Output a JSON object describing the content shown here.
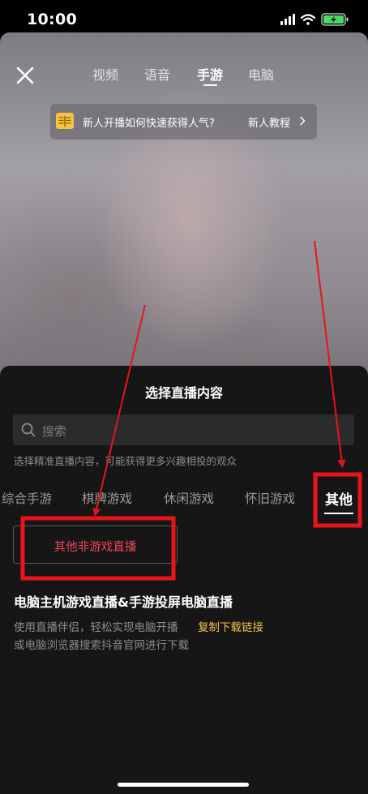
{
  "status_bar": {
    "time": "10:00"
  },
  "top_tabs": [
    "视频",
    "语音",
    "手游",
    "电脑"
  ],
  "top_tab_active": "手游",
  "banner": {
    "text": "新人开播如何快速获得人气?",
    "link_label": "新人教程"
  },
  "sheet": {
    "title": "选择直播内容",
    "search_placeholder": "搜索",
    "hint": "选择精准直播内容，可能获得更多兴趣相投的观众",
    "categories": [
      "综合手游",
      "棋牌游戏",
      "休闲游戏",
      "怀旧游戏",
      "其他"
    ],
    "active_category": "其他",
    "chip_label": "其他非游戏直播"
  },
  "pc_section": {
    "title": "电脑主机游戏直播&手游投屏电脑直播",
    "line1": "使用直播伴侣，轻松实现电脑开播",
    "link": "复制下载链接",
    "line2": "或电脑浏览器搜索抖音官网进行下载"
  },
  "colors": {
    "accent_red": "#f0465a",
    "link_yellow": "#f2c14e",
    "annotation_red": "#e8141c",
    "battery_green": "#4cd964"
  },
  "icons": [
    "signal-icon",
    "wifi-icon",
    "battery-icon",
    "close-icon",
    "book-icon",
    "chevron-right-icon",
    "search-icon"
  ]
}
